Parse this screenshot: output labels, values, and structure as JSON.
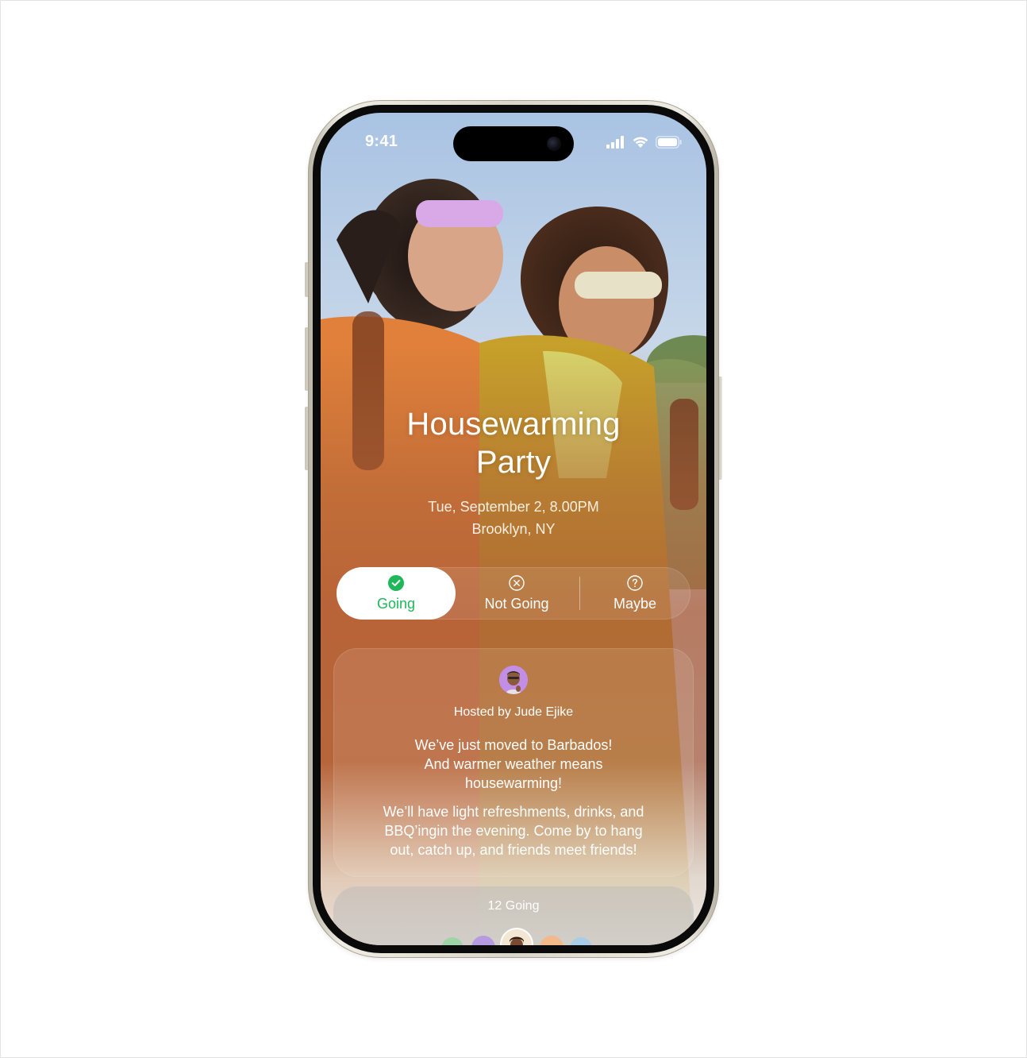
{
  "status_bar": {
    "time": "9:41"
  },
  "event": {
    "title_line1": "Housewarming",
    "title_line2": "Party",
    "date": "Tue, September 2, 8.00PM",
    "location": "Brooklyn, NY"
  },
  "rsvp": {
    "going_label": "Going",
    "not_going_label": "Not Going",
    "maybe_label": "Maybe",
    "selected": "Going",
    "going_icon": "checkmark-circle-icon",
    "not_going_icon": "x-circle-icon",
    "maybe_icon": "question-circle-icon"
  },
  "host": {
    "hosted_by": "Hosted by Jude Ejike",
    "message_lines": [
      "We’ve just moved to Barbados!",
      "And warmer weather means",
      "housewarming!"
    ],
    "details_lines": [
      "We’ll have light refreshments, drinks, and",
      "BBQ’ingin the evening. Come by to hang",
      "out, catch up, and friends meet friends!"
    ]
  },
  "attendees": {
    "count_label": "12 Going"
  },
  "colors": {
    "going_green": "#20b75a",
    "avatar_purple": "#c38ee6"
  }
}
